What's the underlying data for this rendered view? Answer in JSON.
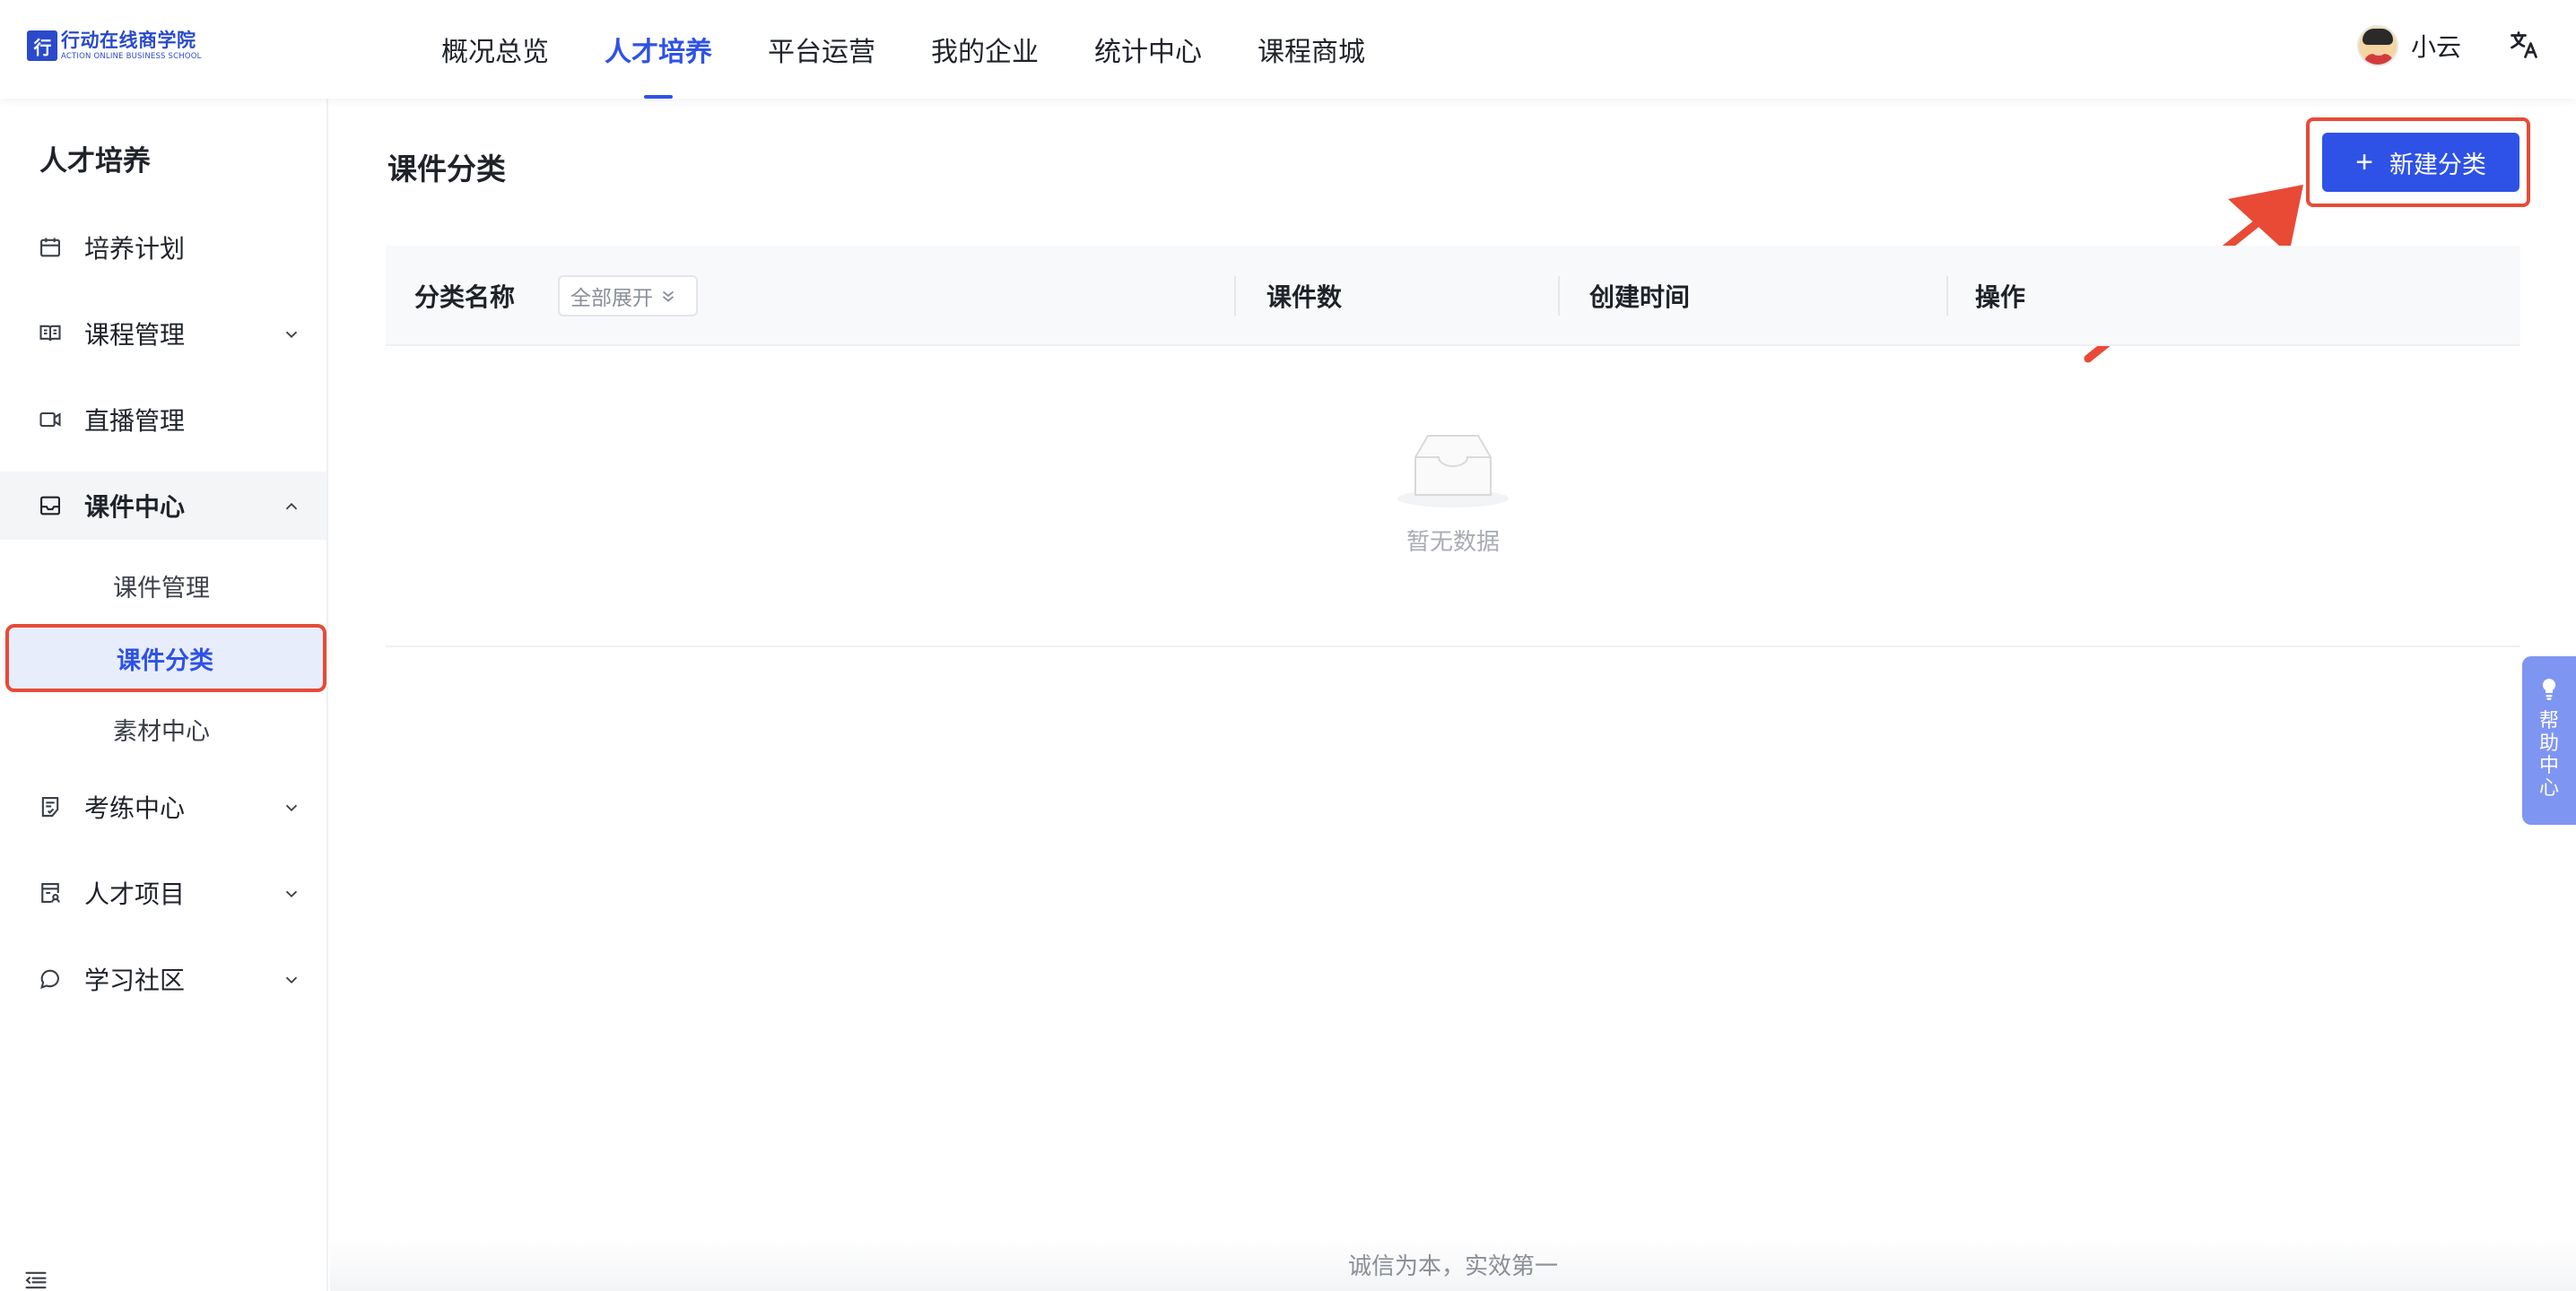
{
  "logo": {
    "mark": "行",
    "cn": "行动在线商学院",
    "en": "ACTION ONLINE BUSINESS SCHOOL"
  },
  "nav": {
    "items": [
      {
        "label": "概况总览"
      },
      {
        "label": "人才培养"
      },
      {
        "label": "平台运营"
      },
      {
        "label": "我的企业"
      },
      {
        "label": "统计中心"
      },
      {
        "label": "课程商城"
      }
    ],
    "active": "人才培养"
  },
  "user": {
    "name": "小云"
  },
  "sidebar": {
    "title": "人才培养",
    "items": [
      {
        "label": "培养计划",
        "icon": "calendar-icon"
      },
      {
        "label": "课程管理",
        "icon": "book-icon"
      },
      {
        "label": "直播管理",
        "icon": "video-icon"
      },
      {
        "label": "课件中心",
        "icon": "inbox-icon"
      },
      {
        "label": "考练中心",
        "icon": "exam-icon"
      },
      {
        "label": "人才项目",
        "icon": "project-icon"
      },
      {
        "label": "学习社区",
        "icon": "chat-icon"
      }
    ],
    "sub_items": [
      {
        "label": "课件管理"
      },
      {
        "label": "课件分类"
      },
      {
        "label": "素材中心"
      }
    ],
    "active_sub": "课件分类"
  },
  "main": {
    "title": "课件分类",
    "new_button": "新建分类",
    "table": {
      "columns": [
        "分类名称",
        "课件数",
        "创建时间",
        "操作"
      ],
      "expand_all": "全部展开",
      "rows": [],
      "empty_text": "暂无数据"
    }
  },
  "footer": {
    "slogan": "诚信为本，实效第一"
  },
  "help": {
    "label": "帮助中心"
  },
  "colors": {
    "primary": "#2e52e6",
    "highlight": "#e84a36",
    "help_bg": "#7f95f2"
  }
}
